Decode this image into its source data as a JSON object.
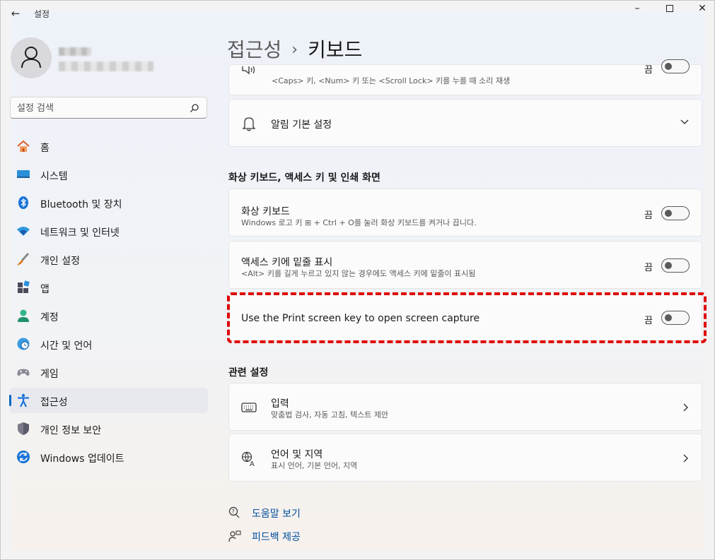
{
  "app": {
    "title": "설정"
  },
  "window": {
    "minimize": "–",
    "close": "✕"
  },
  "search": {
    "placeholder": "설정 검색"
  },
  "nav": {
    "items": [
      {
        "label": "홈",
        "icon": "home-icon"
      },
      {
        "label": "시스템",
        "icon": "system-icon"
      },
      {
        "label": "Bluetooth 및 장치",
        "icon": "bluetooth-icon"
      },
      {
        "label": "네트워크 및 인터넷",
        "icon": "wifi-icon"
      },
      {
        "label": "개인 설정",
        "icon": "brush-icon"
      },
      {
        "label": "앱",
        "icon": "apps-icon"
      },
      {
        "label": "계정",
        "icon": "account-icon"
      },
      {
        "label": "시간 및 언어",
        "icon": "globe-clock-icon"
      },
      {
        "label": "게임",
        "icon": "gamepad-icon"
      },
      {
        "label": "접근성",
        "icon": "accessibility-icon",
        "active": true
      },
      {
        "label": "개인 정보 보안",
        "icon": "shield-icon"
      },
      {
        "label": "Windows 업데이트",
        "icon": "update-icon"
      }
    ]
  },
  "header": {
    "parent": "접근성",
    "separator": "›",
    "current": "키보드"
  },
  "cards": {
    "sound_keys": {
      "desc": "<Caps> 키, <Num> 키 또는 <Scroll Lock> 키를 누를 때 소리 재생",
      "state": "끔"
    },
    "notifications": {
      "title": "알림 기본 설정"
    },
    "section_onscreen": "화상 키보드, 액세스 키 및 인쇄 화면",
    "onscreen_keyboard": {
      "title": "화상 키보드",
      "desc": "Windows 로고 키 ⊞ + Ctrl + O를 눌러 화상 키보드를 켜거나 끕니다.",
      "state": "끔"
    },
    "access_keys": {
      "title": "액세스 키에 밑줄 표시",
      "desc": "<Alt> 키를 길게 누르고 있지 않는 경우에도 액세스 키에 밑줄이 표시됨",
      "state": "끔"
    },
    "print_screen": {
      "title": "Use the Print screen key to open screen capture",
      "state": "끔"
    },
    "section_related": "관련 설정",
    "input": {
      "title": "입력",
      "desc": "맞춤법 검사, 자동 고침, 텍스트 제안"
    },
    "language": {
      "title": "언어 및 지역",
      "desc": "표시 언어, 기본 언어, 지역"
    }
  },
  "footer": {
    "help": "도움말 보기",
    "feedback": "피드백 제공"
  },
  "colors": {
    "accent": "#0067c0",
    "highlight": "#e00000"
  }
}
